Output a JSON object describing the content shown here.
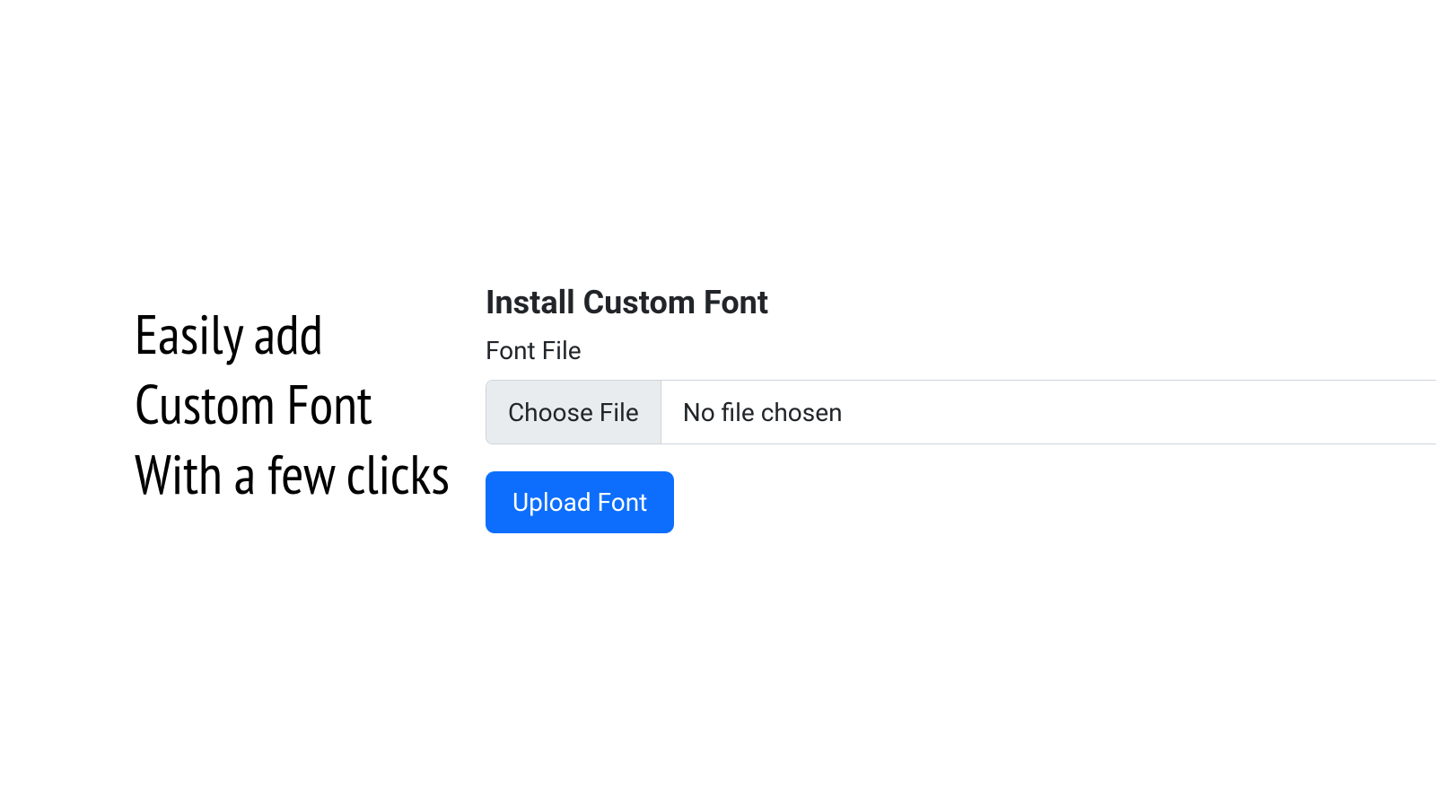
{
  "left": {
    "headline_line1": "Easily add",
    "headline_line2": "Custom Font",
    "headline_line3": "With a few clicks"
  },
  "form": {
    "title": "Install Custom Font",
    "file_label": "Font File",
    "choose_file_label": "Choose File",
    "file_status": "No file chosen",
    "upload_button_label": "Upload Font"
  },
  "colors": {
    "primary_button": "#0d6efd",
    "text_primary": "#212529",
    "border": "#ced4da",
    "file_button_bg": "#e9ecef"
  }
}
